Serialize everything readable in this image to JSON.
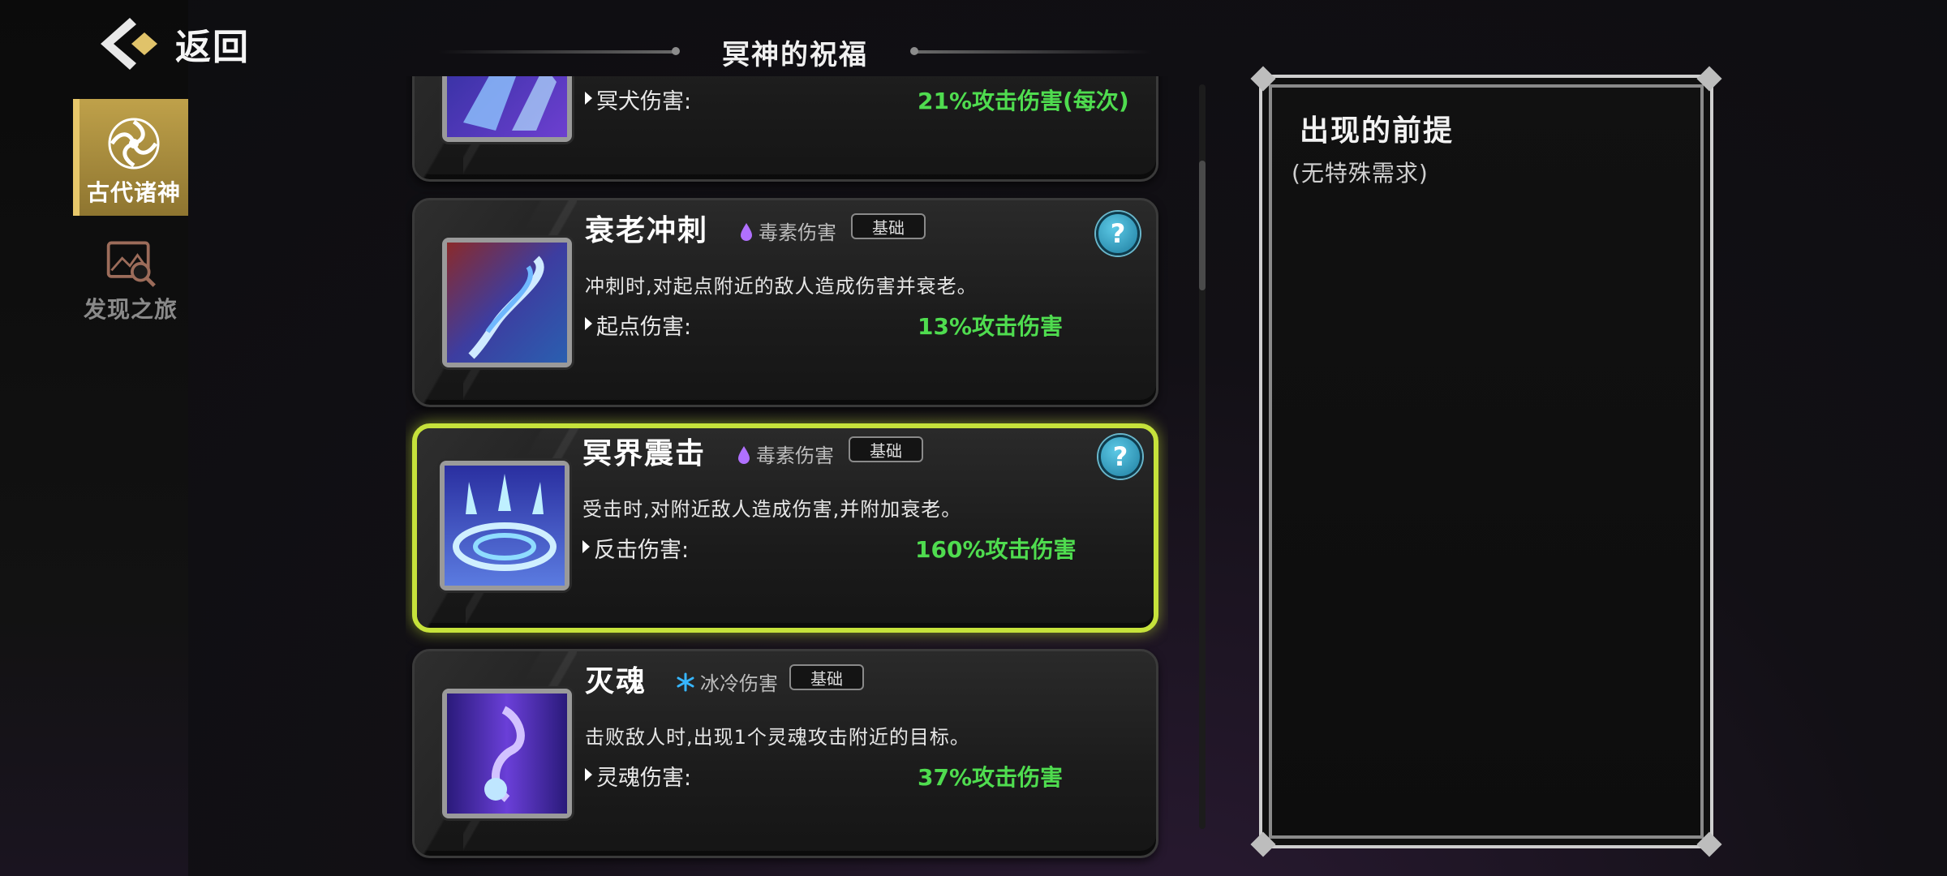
{
  "nav": {
    "back_label": "返回"
  },
  "sidebar": {
    "tabs": [
      {
        "label": "古代诸神",
        "active": true
      },
      {
        "label": "发现之旅",
        "active": false
      }
    ]
  },
  "header": {
    "title": "冥神的祝福"
  },
  "skills": [
    {
      "name": "",
      "damage_type": "",
      "tag": "",
      "description": "",
      "stat_label": "冥犬伤害:",
      "stat_value": "21%攻击伤害(每次)"
    },
    {
      "name": "衰老冲刺",
      "damage_type": "毒素伤害",
      "damage_icon": "poison-drop-icon",
      "tag": "基础",
      "help": "?",
      "description": "冲刺时,对起点附近的敌人造成伤害并衰老。",
      "stat_label": "起点伤害:",
      "stat_value": "13%攻击伤害"
    },
    {
      "name": "冥界震击",
      "damage_type": "毒素伤害",
      "damage_icon": "poison-drop-icon",
      "tag": "基础",
      "help": "?",
      "selected": true,
      "description": "受击时,对附近敌人造成伤害,并附加衰老。",
      "stat_label": "反击伤害:",
      "stat_value": "160%攻击伤害"
    },
    {
      "name": "灭魂",
      "damage_type": "冰冷伤害",
      "damage_icon": "snowflake-icon",
      "tag": "基础",
      "description": "击败敌人时,出现1个灵魂攻击附近的目标。",
      "stat_label": "灵魂伤害:",
      "stat_value": "37%攻击伤害"
    }
  ],
  "info_panel": {
    "title": "出现的前提",
    "subtitle": "(无特殊需求)"
  },
  "colors": {
    "accent_gold": "#bfa14a",
    "selected_border": "#c6e23b",
    "stat_green": "#4fdc4f",
    "poison_purple": "#b070ff",
    "ice_blue": "#37b6ff"
  }
}
